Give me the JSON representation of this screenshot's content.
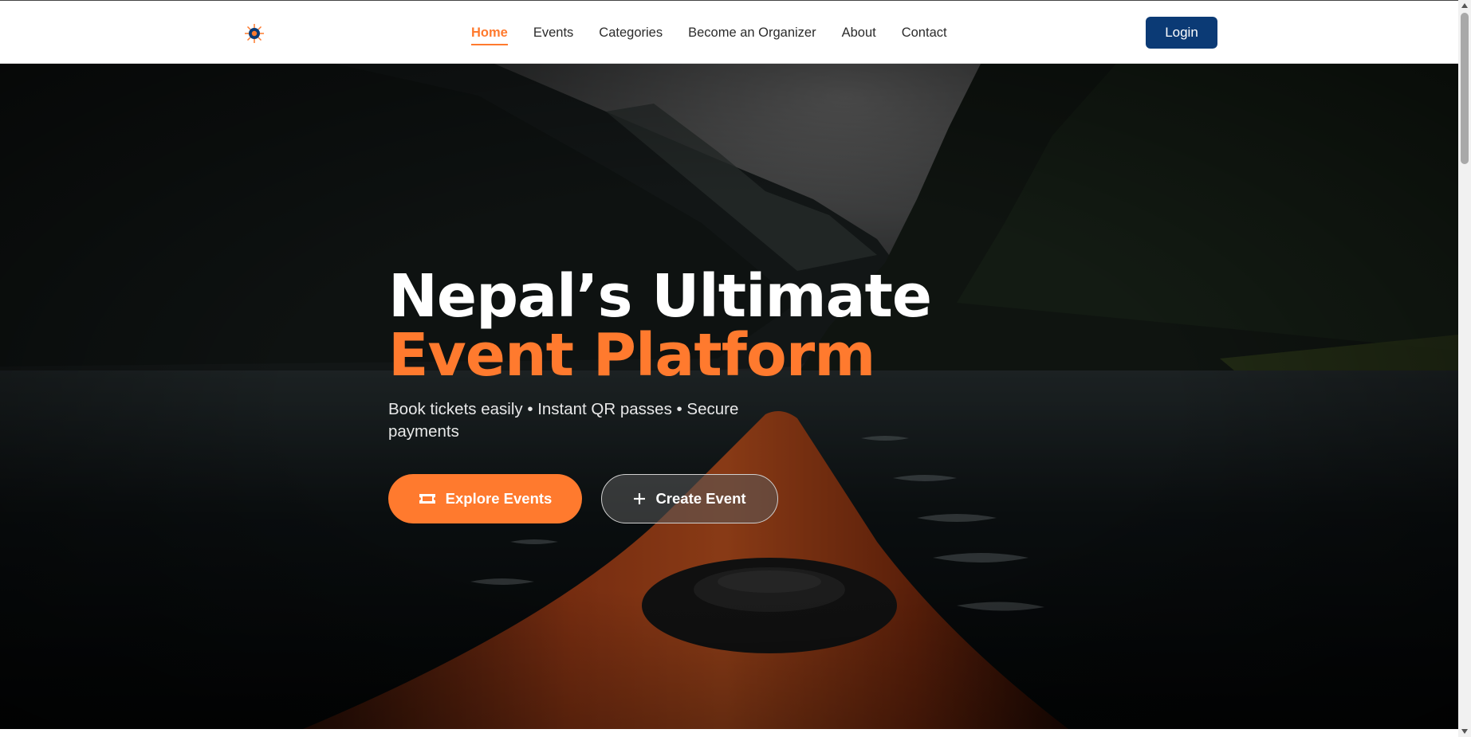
{
  "nav": {
    "logo_icon": "compass-sun-icon",
    "links": [
      {
        "label": "Home",
        "active": true
      },
      {
        "label": "Events",
        "active": false
      },
      {
        "label": "Categories",
        "active": false
      },
      {
        "label": "Become an Organizer",
        "active": false
      },
      {
        "label": "About",
        "active": false
      },
      {
        "label": "Contact",
        "active": false
      }
    ],
    "login_label": "Login"
  },
  "hero": {
    "title_part1": "Nepal’s Ultimate ",
    "title_accent": "Event Platform",
    "subtitle": "Book tickets easily • Instant QR passes • Secure payments",
    "explore_label": "Explore Events",
    "explore_icon": "ticket-icon",
    "create_label": "Create Event",
    "create_icon": "plus-icon",
    "background": "kayak-on-fjord-photo"
  },
  "colors": {
    "accent": "#ff7a2e",
    "primary": "#0b3a75",
    "nav_text": "#2b2b2b"
  }
}
